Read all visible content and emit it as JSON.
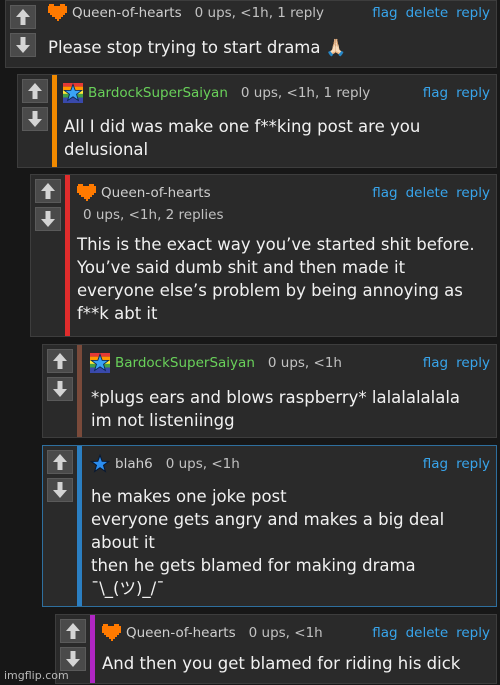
{
  "colors": {
    "link": "#38a5ec",
    "orange_bar": "#f28a00",
    "red_bar": "#e02c2c",
    "brown_bar": "#7a4a3a",
    "blue_bar": "#2b7fc2",
    "purple_bar": "#b026c4",
    "heart_orange": "#ff7a00",
    "username_green": "#69d15a"
  },
  "actions": {
    "flag": "flag",
    "delete": "delete",
    "reply": "reply"
  },
  "comments": [
    {
      "user": "Queen-of-hearts",
      "meta": "0 ups, <1h, 1 reply",
      "text": "Please stop trying to start drama 🙏🏻",
      "icon": "heart-icon"
    },
    {
      "user": "BardockSuperSaiyan",
      "meta": "0 ups, <1h, 1 reply",
      "text": "All I did was make one f**king post are you\ndelusional",
      "icon": "rainbow-star-icon"
    },
    {
      "user": "Queen-of-hearts",
      "meta": "0 ups, <1h, 2 replies",
      "text": "This is the exact way you’ve started shit before.\nYou’ve said dumb shit and then made it\neveryone else’s problem by being annoying as\nf**k abt it",
      "icon": "heart-icon"
    },
    {
      "user": "BardockSuperSaiyan",
      "meta": "0 ups, <1h",
      "text": "*plugs ears and blows raspberry* lalalalalala\nim not listeniingg",
      "icon": "rainbow-star-icon"
    },
    {
      "user": "blah6",
      "meta": "0 ups, <1h",
      "text": "he makes one joke post\neveryone gets angry and makes a big deal\nabout it\nthen he gets blamed for making drama\n¯\\_(ツ)_/¯",
      "icon": "blue-star-icon"
    },
    {
      "user": "Queen-of-hearts",
      "meta": "0 ups, <1h",
      "text": "And then you get blamed for riding his dick",
      "icon": "heart-icon"
    }
  ],
  "watermark": "imgflip.com"
}
